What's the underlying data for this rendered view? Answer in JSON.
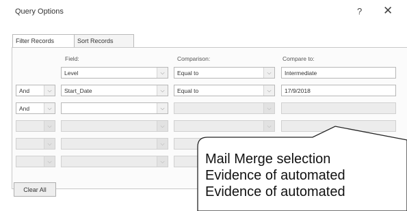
{
  "dialog": {
    "title": "Query Options",
    "help_label": "?",
    "close_label": "✕"
  },
  "tabs": [
    {
      "label": "Filter Records",
      "active": true
    },
    {
      "label": "Sort Records",
      "active": false
    }
  ],
  "columns": {
    "field": "Field:",
    "comparison": "Comparison:",
    "compare_to": "Compare to:"
  },
  "rows": [
    {
      "join": "",
      "field": "Level",
      "comparison": "Equal to",
      "compare_to": "Intermediate"
    },
    {
      "join": "And",
      "field": "Start_Date",
      "comparison": "Equal to",
      "compare_to": "17/9/2018"
    },
    {
      "join": "And",
      "field": "",
      "comparison": "",
      "compare_to": ""
    },
    {
      "join": "",
      "field": "",
      "comparison": "",
      "compare_to": ""
    },
    {
      "join": "",
      "field": "",
      "comparison": "",
      "compare_to": ""
    },
    {
      "join": "",
      "field": "",
      "comparison": "",
      "compare_to": ""
    }
  ],
  "buttons": {
    "clear_all": "Clear All"
  },
  "callout": {
    "lines": [
      "Mail Merge selection",
      "Evidence of automated",
      "Evidence of automated"
    ]
  },
  "icons": {
    "dropdown": "chevron-down-icon"
  }
}
